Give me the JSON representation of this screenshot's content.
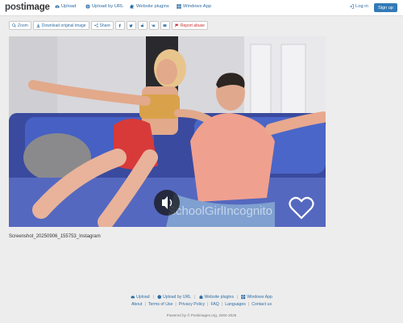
{
  "header": {
    "logo_part1": "post",
    "logo_part2": "image",
    "nav": [
      {
        "label": "Upload",
        "icon": "cloud-upload-icon"
      },
      {
        "label": "Upload by URL",
        "icon": "globe-icon"
      },
      {
        "label": "Website plugins",
        "icon": "puzzle-icon"
      },
      {
        "label": "Windows App",
        "icon": "windows-icon"
      }
    ],
    "login_label": "Log in",
    "signup_label": "Sign up",
    "accent": "#337ab7"
  },
  "toolbar": {
    "zoom_label": "Zoom",
    "download_label": "Download original image",
    "share_label": "Share",
    "social_icons": [
      "facebook-icon",
      "twitter-icon",
      "reddit-icon",
      "vk-icon",
      "email-icon"
    ],
    "report_label": "Report abuse"
  },
  "image": {
    "watermark": "SchoolGirlIncognito"
  },
  "caption": "Screenshot_20250906_155753_Instagram",
  "footer": {
    "row1": [
      {
        "label": "Upload",
        "icon": "cloud-upload-icon"
      },
      {
        "label": "Upload by URL",
        "icon": "globe-icon"
      },
      {
        "label": "Website plugins",
        "icon": "puzzle-icon"
      },
      {
        "label": "Windows App",
        "icon": "windows-icon"
      }
    ],
    "row2": [
      "About",
      "Terms of Use",
      "Privacy Policy",
      "FAQ",
      "Languages",
      "Contact us"
    ],
    "powered": "Powered by © Postimages.org, 2004-2025"
  }
}
